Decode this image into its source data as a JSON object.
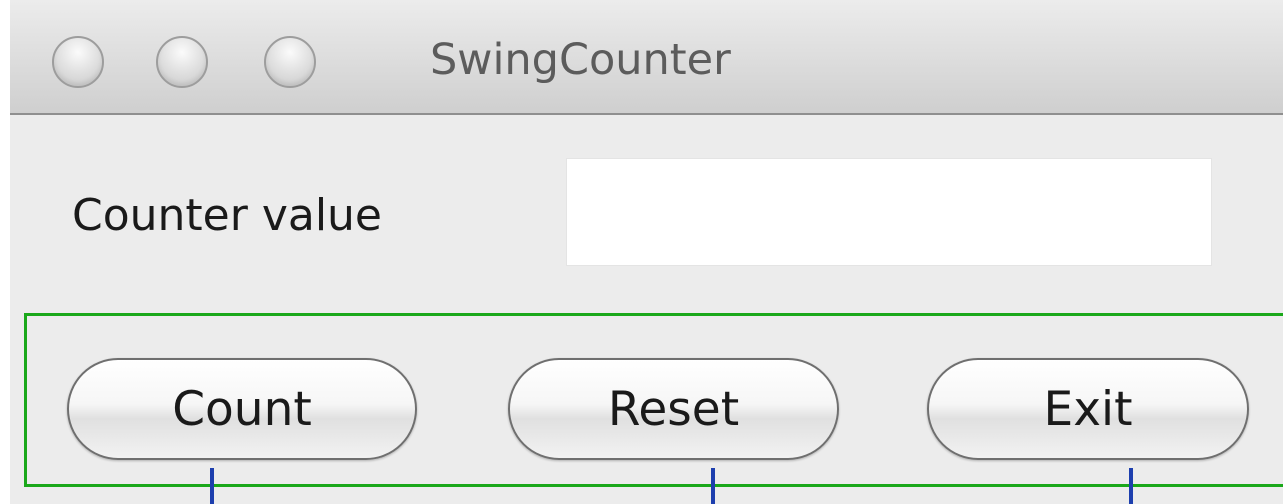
{
  "window": {
    "title": "SwingCounter",
    "controls": [
      "close-button",
      "minimize-button",
      "zoom-button"
    ]
  },
  "form": {
    "counter_label": "Counter value",
    "counter_value": "",
    "counter_placeholder": ""
  },
  "buttons": {
    "count_label": "Count",
    "reset_label": "Reset",
    "exit_label": "Exit"
  },
  "annotations": {
    "panel_outline_color": "#1aa81a",
    "marker_color": "#1d3fae"
  }
}
